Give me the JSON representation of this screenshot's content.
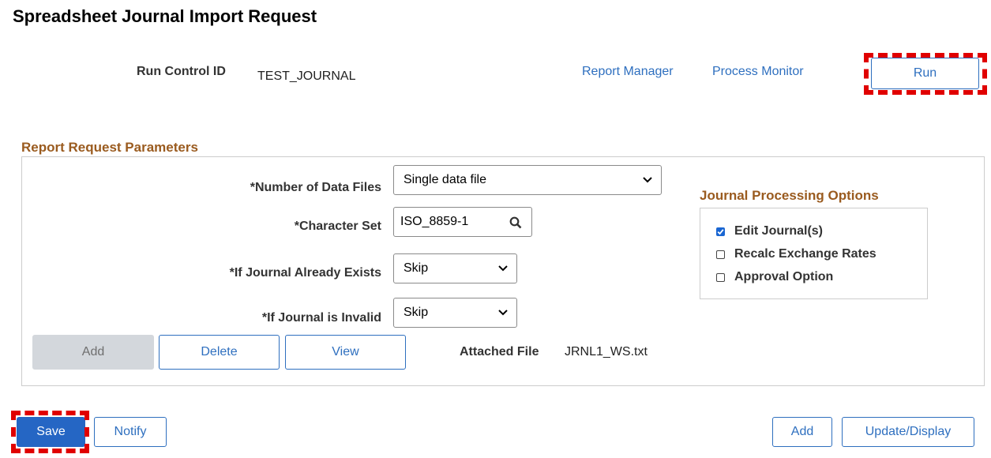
{
  "page": {
    "title": "Spreadsheet Journal Import Request"
  },
  "header": {
    "run_control_label": "Run Control ID",
    "run_control_value": "TEST_JOURNAL",
    "report_manager_link": "Report Manager",
    "process_monitor_link": "Process Monitor",
    "run_button": "Run"
  },
  "params": {
    "section_title": "Report Request Parameters",
    "num_files_label": "*Number of Data Files",
    "num_files_value": "Single data file",
    "charset_label": "*Character Set",
    "charset_value": "ISO_8859-1",
    "journal_exists_label": "*If Journal Already Exists",
    "journal_exists_value": "Skip",
    "journal_invalid_label": "*If Journal is Invalid",
    "journal_invalid_value": "Skip",
    "add_button": "Add",
    "delete_button": "Delete",
    "view_button": "View",
    "attached_file_label": "Attached File",
    "attached_file_value": "JRNL1_WS.txt"
  },
  "options": {
    "title": "Journal Processing Options",
    "items": [
      {
        "label": "Edit Journal(s)",
        "checked": true
      },
      {
        "label": "Recalc Exchange Rates",
        "checked": false
      },
      {
        "label": "Approval Option",
        "checked": false
      }
    ]
  },
  "footer": {
    "save_button": "Save",
    "notify_button": "Notify",
    "add_button": "Add",
    "update_display_button": "Update/Display"
  },
  "colors": {
    "accent": "#2e6fbf",
    "primary_button": "#2566c4",
    "section_title": "#9a5b1f",
    "highlight_dash": "#e00000"
  }
}
